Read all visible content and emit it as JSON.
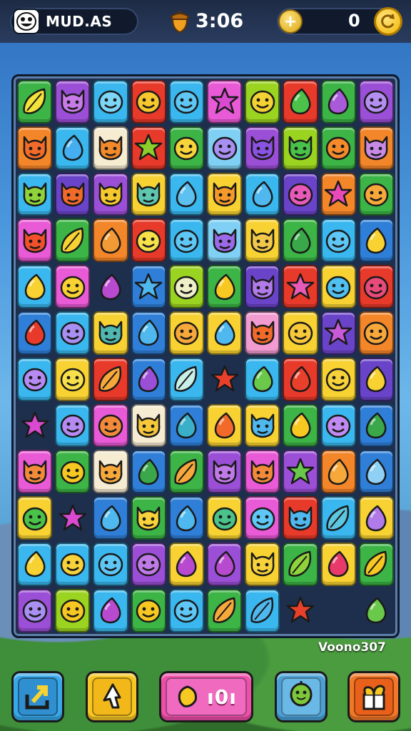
{
  "header": {
    "player_name": "MUD.AS",
    "timer": "3:06",
    "coin_count": "0",
    "avatar_icon": "smiling-face-icon",
    "timer_icon": "acorn-icon",
    "plus_icon": "plus-icon",
    "coin_icon": "gold-coin-icon"
  },
  "board": {
    "columns": 10,
    "rows": 12,
    "colors": {
      "lime": "#9bd321",
      "purple": "#9a4fd6",
      "cyan": "#39b7ee",
      "red": "#e83a2a",
      "green": "#3cb446",
      "magenta": "#e85ad6",
      "orange": "#f4862a",
      "yellow": "#f7d232",
      "pink": "#f29bd0",
      "blue": "#2f7fd8",
      "violet": "#6a44c8",
      "cream": "#f6ecd2",
      "teal": "#23a8a0",
      "lightblue": "#7fd0f4"
    },
    "tiles": [
      [
        {
          "bg": "green",
          "c": "#f2e23a",
          "s": "leaf"
        },
        {
          "bg": "purple",
          "c": "#c77ae8",
          "s": "devil"
        },
        {
          "bg": "cyan",
          "c": "#7dd6f7",
          "s": "face"
        },
        {
          "bg": "red",
          "c": "#f6c82e",
          "s": "face"
        },
        {
          "bg": "cyan",
          "c": "#5ec7f5",
          "s": "face"
        },
        {
          "bg": "magenta",
          "c": "#d94ad0",
          "s": "star"
        },
        {
          "bg": "lime",
          "c": "#f5d234",
          "s": "face"
        },
        {
          "bg": "red",
          "c": "#4cc24a",
          "s": "drop"
        },
        {
          "bg": "green",
          "c": "#a85ad8",
          "s": "drop"
        },
        {
          "bg": "purple",
          "c": "#b48ef0",
          "s": "face"
        }
      ],
      [
        {
          "bg": "orange",
          "c": "#f26a2a",
          "s": "devil"
        },
        {
          "bg": "cyan",
          "c": "#45aef0",
          "s": "drop"
        },
        {
          "bg": "cream",
          "c": "#f28a2a",
          "s": "devil"
        },
        {
          "bg": "red",
          "c": "#8ccf2a",
          "s": "star"
        },
        {
          "bg": "green",
          "c": "#f7d43a",
          "s": "face"
        },
        {
          "bg": "lightblue",
          "c": "#a88ff2",
          "s": "face"
        },
        {
          "bg": "purple",
          "c": "#8a52e0",
          "s": "devil"
        },
        {
          "bg": "lime",
          "c": "#49c24a",
          "s": "devil"
        },
        {
          "bg": "green",
          "c": "#f48a2a",
          "s": "face"
        },
        {
          "bg": "orange",
          "c": "#c98ae6",
          "s": "devil"
        }
      ],
      [
        {
          "bg": "cyan",
          "c": "#8fd33a",
          "s": "devil"
        },
        {
          "bg": "violet",
          "c": "#f26a2a",
          "s": "devil"
        },
        {
          "bg": "purple",
          "c": "#f6c82e",
          "s": "devil"
        },
        {
          "bg": "yellow",
          "c": "#5ec7b0",
          "s": "devil"
        },
        {
          "bg": "cyan",
          "c": "#5cc0f0",
          "s": "drop"
        },
        {
          "bg": "yellow",
          "c": "#f59a2a",
          "s": "devil"
        },
        {
          "bg": "cyan",
          "c": "#4fb8ee",
          "s": "drop"
        },
        {
          "bg": "violet",
          "c": "#e85ab8",
          "s": "face"
        },
        {
          "bg": "orange",
          "c": "#e84ab8",
          "s": "star"
        },
        {
          "bg": "green",
          "c": "#f7a83a",
          "s": "face"
        }
      ],
      [
        {
          "bg": "magenta",
          "c": "#f2502a",
          "s": "devil"
        },
        {
          "bg": "green",
          "c": "#f7d232",
          "s": "leaf"
        },
        {
          "bg": "orange",
          "c": "#f29a36",
          "s": "drop"
        },
        {
          "bg": "red",
          "c": "#f7e04a",
          "s": "face"
        },
        {
          "bg": "cyan",
          "c": "#5ec7f5",
          "s": "face"
        },
        {
          "bg": "lightblue",
          "c": "#9a6ae8",
          "s": "devil"
        },
        {
          "bg": "yellow",
          "c": "#f2c84a",
          "s": "devil"
        },
        {
          "bg": "green",
          "c": "#3aa84a",
          "s": "drop"
        },
        {
          "bg": "cyan",
          "c": "#5ec7f5",
          "s": "face"
        },
        {
          "bg": "blue",
          "c": "#f7d232",
          "s": "drop"
        }
      ],
      [
        {
          "bg": "cyan",
          "c": "#f7d232",
          "s": "drop"
        },
        {
          "bg": "magenta",
          "c": "#f7d232",
          "s": "face"
        },
        {
          "bg": "empty",
          "c": "#b84ad0",
          "s": "drop"
        },
        {
          "bg": "blue",
          "c": "#4fb8ee",
          "s": "star"
        },
        {
          "bg": "lime",
          "c": "#eef0c8",
          "s": "face"
        },
        {
          "bg": "green",
          "c": "#f7c822",
          "s": "drop"
        },
        {
          "bg": "violet",
          "c": "#b07ae8",
          "s": "devil"
        },
        {
          "bg": "red",
          "c": "#e85ab8",
          "s": "star"
        },
        {
          "bg": "yellow",
          "c": "#4fc0f0",
          "s": "face"
        },
        {
          "bg": "red",
          "c": "#e84a7a",
          "s": "face"
        }
      ],
      [
        {
          "bg": "blue",
          "c": "#e83a2a",
          "s": "drop"
        },
        {
          "bg": "cyan",
          "c": "#a88ff2",
          "s": "face"
        },
        {
          "bg": "yellow",
          "c": "#4fb8b0",
          "s": "devil"
        },
        {
          "bg": "blue",
          "c": "#4fb8ee",
          "s": "drop"
        },
        {
          "bg": "yellow",
          "c": "#f7a83a",
          "s": "face"
        },
        {
          "bg": "yellow",
          "c": "#4fb8ee",
          "s": "drop"
        },
        {
          "bg": "pink",
          "c": "#f26a2a",
          "s": "devil"
        },
        {
          "bg": "yellow",
          "c": "#f7c83a",
          "s": "face"
        },
        {
          "bg": "violet",
          "c": "#c85ad8",
          "s": "star"
        },
        {
          "bg": "orange",
          "c": "#f7a83a",
          "s": "face"
        }
      ],
      [
        {
          "bg": "cyan",
          "c": "#b58af2",
          "s": "face"
        },
        {
          "bg": "yellow",
          "c": "#f7e04a",
          "s": "face"
        },
        {
          "bg": "red",
          "c": "#f7a83a",
          "s": "leaf"
        },
        {
          "bg": "blue",
          "c": "#9a4fd6",
          "s": "drop"
        },
        {
          "bg": "cyan",
          "c": "#c8f0e8",
          "s": "leaf"
        },
        {
          "bg": "empty",
          "c": "#e8402a",
          "s": "star"
        },
        {
          "bg": "cyan",
          "c": "#6ac84a",
          "s": "drop"
        },
        {
          "bg": "red",
          "c": "#e8402a",
          "s": "drop"
        },
        {
          "bg": "yellow",
          "c": "#f7d23a",
          "s": "face"
        },
        {
          "bg": "violet",
          "c": "#f7d232",
          "s": "drop"
        }
      ],
      [
        {
          "bg": "empty",
          "c": "#d94ad0",
          "s": "star"
        },
        {
          "bg": "cyan",
          "c": "#b58af2",
          "s": "face"
        },
        {
          "bg": "magenta",
          "c": "#f28a3a",
          "s": "face"
        },
        {
          "bg": "cream",
          "c": "#f7c83a",
          "s": "devil"
        },
        {
          "bg": "blue",
          "c": "#39b0c8",
          "s": "drop"
        },
        {
          "bg": "yellow",
          "c": "#f26a2a",
          "s": "drop"
        },
        {
          "bg": "yellow",
          "c": "#4fb8ee",
          "s": "devil"
        },
        {
          "bg": "green",
          "c": "#f7c822",
          "s": "drop"
        },
        {
          "bg": "cyan",
          "c": "#c08af2",
          "s": "face"
        },
        {
          "bg": "blue",
          "c": "#3aa84a",
          "s": "drop"
        }
      ],
      [
        {
          "bg": "magenta",
          "c": "#f28a3a",
          "s": "devil"
        },
        {
          "bg": "green",
          "c": "#f7c822",
          "s": "face"
        },
        {
          "bg": "cream",
          "c": "#f7a83a",
          "s": "devil"
        },
        {
          "bg": "blue",
          "c": "#3aa84a",
          "s": "drop"
        },
        {
          "bg": "green",
          "c": "#f7a83a",
          "s": "leaf"
        },
        {
          "bg": "purple",
          "c": "#c07ae8",
          "s": "devil"
        },
        {
          "bg": "magenta",
          "c": "#f28a3a",
          "s": "devil"
        },
        {
          "bg": "purple",
          "c": "#6ac84a",
          "s": "star"
        },
        {
          "bg": "orange",
          "c": "#f7a83a",
          "s": "drop"
        },
        {
          "bg": "blue",
          "c": "#8fd0f4",
          "s": "drop"
        }
      ],
      [
        {
          "bg": "yellow",
          "c": "#4ac24a",
          "s": "face"
        },
        {
          "bg": "empty",
          "c": "#d94ad0",
          "s": "star"
        },
        {
          "bg": "blue",
          "c": "#4fb8ee",
          "s": "drop"
        },
        {
          "bg": "green",
          "c": "#f7d23a",
          "s": "devil"
        },
        {
          "bg": "blue",
          "c": "#4fb8ee",
          "s": "drop"
        },
        {
          "bg": "yellow",
          "c": "#4ac28a",
          "s": "face"
        },
        {
          "bg": "magenta",
          "c": "#5ec7f5",
          "s": "face"
        },
        {
          "bg": "red",
          "c": "#4fb8ee",
          "s": "devil"
        },
        {
          "bg": "cyan",
          "c": "#5ec7e0",
          "s": "leaf"
        },
        {
          "bg": "yellow",
          "c": "#b07ae8",
          "s": "drop"
        }
      ],
      [
        {
          "bg": "cyan",
          "c": "#f7d232",
          "s": "drop"
        },
        {
          "bg": "cyan",
          "c": "#f7d23a",
          "s": "face"
        },
        {
          "bg": "cyan",
          "c": "#5ec7f5",
          "s": "face"
        },
        {
          "bg": "purple",
          "c": "#c07ae8",
          "s": "face"
        },
        {
          "bg": "yellow",
          "c": "#b84ad0",
          "s": "drop"
        },
        {
          "bg": "purple",
          "c": "#b84ad0",
          "s": "drop"
        },
        {
          "bg": "yellow",
          "c": "#f7d23a",
          "s": "devil"
        },
        {
          "bg": "green",
          "c": "#8fd33a",
          "s": "leaf"
        },
        {
          "bg": "yellow",
          "c": "#e83a6a",
          "s": "drop"
        },
        {
          "bg": "green",
          "c": "#f7c822",
          "s": "leaf"
        }
      ],
      [
        {
          "bg": "purple",
          "c": "#a88ff2",
          "s": "face"
        },
        {
          "bg": "lime",
          "c": "#f7c822",
          "s": "face"
        },
        {
          "bg": "cyan",
          "c": "#b84ad0",
          "s": "drop"
        },
        {
          "bg": "green",
          "c": "#f7c822",
          "s": "face"
        },
        {
          "bg": "cyan",
          "c": "#5ec7f5",
          "s": "face"
        },
        {
          "bg": "green",
          "c": "#f7a83a",
          "s": "leaf"
        },
        {
          "bg": "cyan",
          "c": "#4fb8ee",
          "s": "leaf"
        },
        {
          "bg": "empty",
          "c": "#e8402a",
          "s": "star"
        },
        {
          "bg": "empty",
          "c": "#1d2f4d",
          "s": "none"
        },
        {
          "bg": "empty",
          "c": "#6ac84a",
          "s": "drop"
        }
      ]
    ]
  },
  "footer": {
    "level_code": "Voono307",
    "boost_count": "ı0ı",
    "back_icon": "exit-arrow-icon",
    "hint_icon": "cursor-hand-icon",
    "boost_icon": "gold-gem-icon",
    "character_icon": "green-character-icon",
    "shop_icon": "gift-box-icon"
  }
}
